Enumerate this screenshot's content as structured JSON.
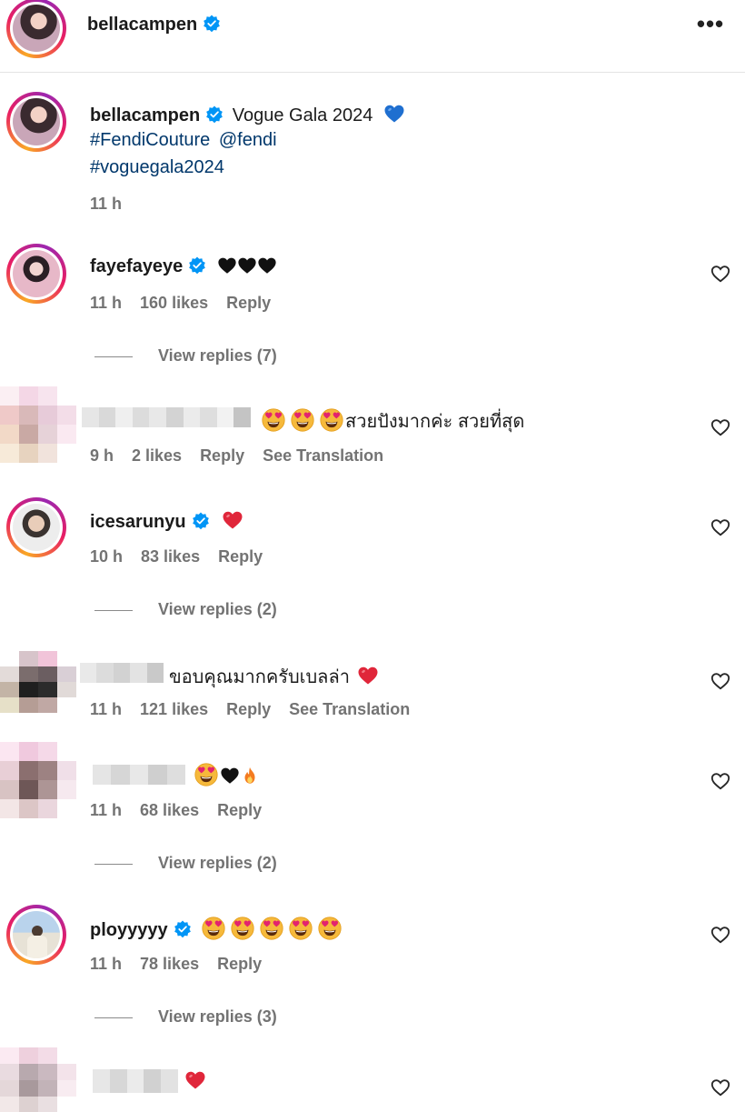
{
  "post": {
    "author": "bellacampen",
    "more_label": "•••",
    "caption": {
      "title": "Vogue Gala 2024",
      "hashtag1": "#FendiCouture",
      "mention": "@fendi",
      "hashtag2": "#voguegala2024",
      "time": "11 h"
    }
  },
  "comments": [
    {
      "username": "fayefayeye",
      "time": "11 h",
      "likes": "160 likes",
      "reply": "Reply",
      "view_replies": "View replies (7)"
    },
    {
      "text": "สวยปังมากค่ะ สวยที่สุด",
      "time": "9 h",
      "likes": "2 likes",
      "reply": "Reply",
      "translate": "See Translation"
    },
    {
      "username": "icesarunyu",
      "time": "10 h",
      "likes": "83 likes",
      "reply": "Reply",
      "view_replies": "View replies (2)"
    },
    {
      "text": "ขอบคุณมากครับเบลล่า",
      "time": "11 h",
      "likes": "121 likes",
      "reply": "Reply",
      "translate": "See Translation"
    },
    {
      "time": "11 h",
      "likes": "68 likes",
      "reply": "Reply",
      "view_replies": "View replies (2)"
    },
    {
      "username": "ployyyyy",
      "time": "11 h",
      "likes": "78 likes",
      "reply": "Reply",
      "view_replies": "View replies (3)"
    },
    {}
  ],
  "icons": {
    "verified": "verified-badge-icon",
    "like": "heart-outline-icon",
    "more": "more-horizontal-icon"
  },
  "colors": {
    "link": "#00376b",
    "meta": "#737373",
    "verified": "#0095f6"
  }
}
